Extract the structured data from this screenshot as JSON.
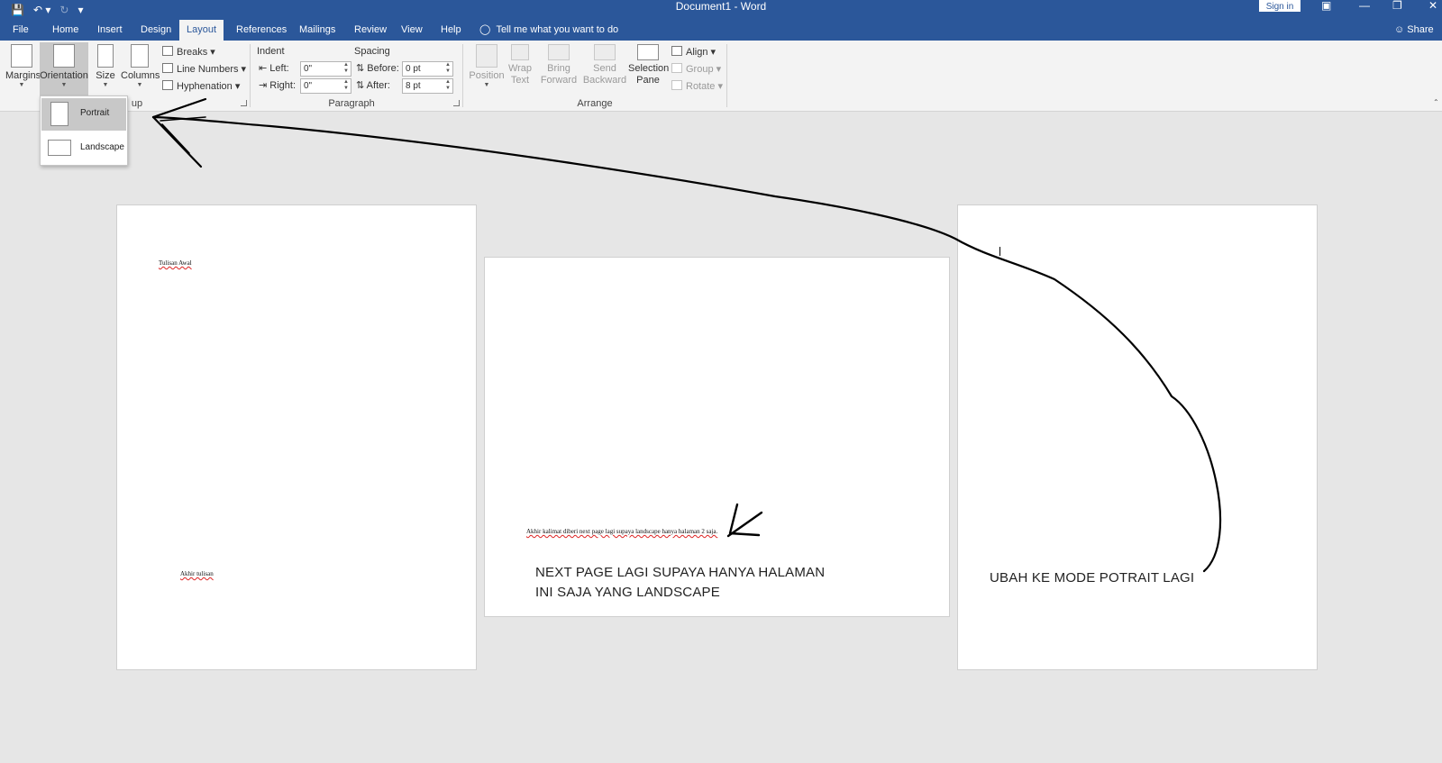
{
  "window": {
    "title": "Document1 - Word",
    "signin_label": "Sign in",
    "quick_access_icons": [
      "save-icon",
      "undo-icon",
      "redo-icon",
      "customize-icon"
    ]
  },
  "tabs": [
    "File",
    "Home",
    "Insert",
    "Design",
    "Layout",
    "References",
    "Mailings",
    "Review",
    "View",
    "Help"
  ],
  "active_tab": "Layout",
  "tell_me": "Tell me what you want to do",
  "share_label": "Share",
  "ribbon": {
    "page_setup": {
      "margins": "Margins",
      "orientation": "Orientation",
      "size": "Size",
      "columns": "Columns",
      "breaks": "Breaks",
      "line_numbers": "Line Numbers",
      "hyphenation": "Hyphenation",
      "group_label_visible": "up"
    },
    "paragraph": {
      "indent_label": "Indent",
      "spacing_label": "Spacing",
      "left_label": "Left:",
      "right_label": "Right:",
      "before_label": "Before:",
      "after_label": "After:",
      "left_value": "0\"",
      "right_value": "0\"",
      "before_value": "0 pt",
      "after_value": "8 pt",
      "group_label": "Paragraph"
    },
    "arrange": {
      "position": "Position",
      "wrap_text_1": "Wrap",
      "wrap_text_2": "Text",
      "bring_forward_1": "Bring",
      "bring_forward_2": "Forward",
      "send_backward_1": "Send",
      "send_backward_2": "Backward",
      "selection_pane_1": "Selection",
      "selection_pane_2": "Pane",
      "align": "Align",
      "group": "Group",
      "rotate": "Rotate",
      "group_label": "Arrange"
    }
  },
  "orientation_menu": {
    "portrait": "Portrait",
    "landscape": "Landscape",
    "selected": "Portrait"
  },
  "pages": {
    "page1": {
      "top_text": "Tulisan Awal",
      "bottom_text": "Akhir tulisan"
    },
    "page2": {
      "small_text": "Akhir kalimat diberi next page lagi supaya landscape hanya halaman 2 saja.",
      "note_line1": "NEXT PAGE LAGI SUPAYA HANYA HALAMAN",
      "note_line2": "INI SAJA YANG LANDSCAPE"
    },
    "page3": {
      "note": "UBAH KE MODE POTRAIT LAGI"
    }
  },
  "colors": {
    "titlebar": "#2b579a",
    "ribbon": "#f3f3f3",
    "canvas": "#e6e6e6",
    "page": "#ffffff",
    "annotation_ink": "#000000"
  }
}
